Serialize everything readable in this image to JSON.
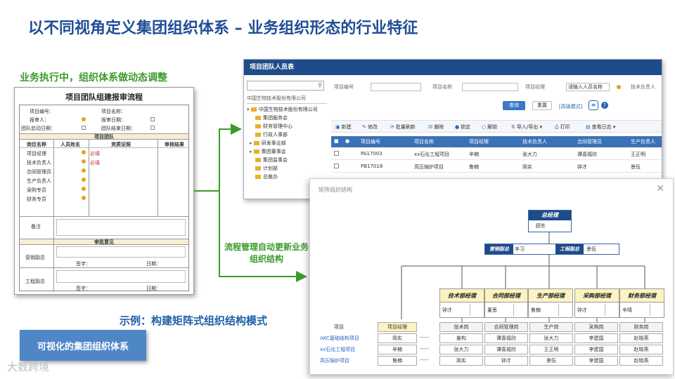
{
  "slide": {
    "title": "以不同视角定义集团组织体系 – 业务组织形态的行业特征",
    "left_subtitle": "业务执行中，组织体系做动态调整",
    "flow_label": "流程管理自动更新业务组织结构",
    "example_label": "示例：构建矩阵式组织结构模式",
    "visual_button": "可视化的集团组织体系",
    "watermark": "大数跨境"
  },
  "form": {
    "title": "项目团队组建报审流程",
    "fields": {
      "project_no": "项目编号：",
      "project_name": "项目名称：",
      "reporter": "报审人：",
      "report_date": "报审日期：",
      "team_start": "团队启动日期：",
      "team_end": "团队结束日期："
    },
    "team_section": "项目团队",
    "columns": [
      "岗位名称",
      "人员姓名",
      "资质证照",
      "审核结果"
    ],
    "roles": [
      "项目经理",
      "技术负责人",
      "合同管理员",
      "生产负责人",
      "采购专员",
      "财务专员"
    ],
    "required_mark": "必填",
    "remark_label": "备注",
    "review_section": "审批意见",
    "reviewers": [
      "营销副总",
      "工程副总"
    ],
    "sign_label": "签字：",
    "date_label": "日期："
  },
  "member_window": {
    "title": "项目团队人员表",
    "tree": {
      "selected": "中国生物技术股份有限公司",
      "root": "中国生物技术股份有限公司",
      "items": [
        "集团服务会",
        "财务管理中心",
        "行政人事部",
        "研发事业部",
        "集团董事会",
        "集团监事会",
        "计划部",
        "总裁办"
      ]
    },
    "search": {
      "project_no_label": "项目编号",
      "project_name_label": "项目名称",
      "pm_label": "项目经理",
      "pm_placeholder": "请输入人员名称",
      "tech_label": "技术负责人",
      "query_btn": "查询",
      "reset_btn": "重置",
      "advanced_link": "[高级模式]"
    },
    "toolbar": [
      "新建",
      "修改",
      "批量刷新",
      "删除",
      "锁定",
      "解锁",
      "导入/导出",
      "打印",
      "查看日志"
    ],
    "columns": [
      "项目编号",
      "项目名称",
      "项目经理",
      "技术负责人",
      "合同管理员",
      "生产负责人"
    ],
    "rows": [
      [
        "PA17003",
        "xx石化工程项目",
        "辛楠",
        "张大力",
        "谭喜福欣",
        "王正明"
      ],
      [
        "PB17018",
        "高压锅炉项目",
        "鲁楠",
        "简实",
        "钟才",
        "景伍"
      ]
    ]
  },
  "matrix_dialog": {
    "title": "矩阵组织结构",
    "gm": {
      "title": "总经理",
      "name": "顾东"
    },
    "vps": [
      {
        "title": "营销副总",
        "name": "辛习"
      },
      {
        "title": "工程副总",
        "name": "景伍"
      }
    ],
    "departments": [
      {
        "title": "技术部经理",
        "name": "钟才"
      },
      {
        "title": "合同部经理",
        "name": "董思"
      },
      {
        "title": "生产部经理",
        "name": "鲁楠"
      },
      {
        "title": "采购部经理",
        "name": "钟才"
      },
      {
        "title": "财务部经理",
        "name": "辛晴"
      }
    ],
    "project_header": "项目",
    "pm_header": "项目经理",
    "role_headers": [
      "技术岗",
      "合同管理岗",
      "生产岗",
      "采购岗",
      "财务岗"
    ],
    "dashes": "-----",
    "projects": [
      {
        "name": "AKC基础结构项目",
        "pm": "简实",
        "cells": [
          "姜构",
          "谭喜福欣",
          "张大力",
          "李建国",
          "赵晓燕"
        ]
      },
      {
        "name": "xx石化工程项目",
        "pm": "辛楠",
        "cells": [
          "张大力",
          "谭喜福欣",
          "王正明",
          "李建国",
          "赵晓燕"
        ]
      },
      {
        "name": "高压锅炉项目",
        "pm": "鲁楠",
        "cells": [
          "简实",
          "钟才",
          "景伍",
          "李建国",
          "赵晓燕"
        ]
      }
    ]
  }
}
